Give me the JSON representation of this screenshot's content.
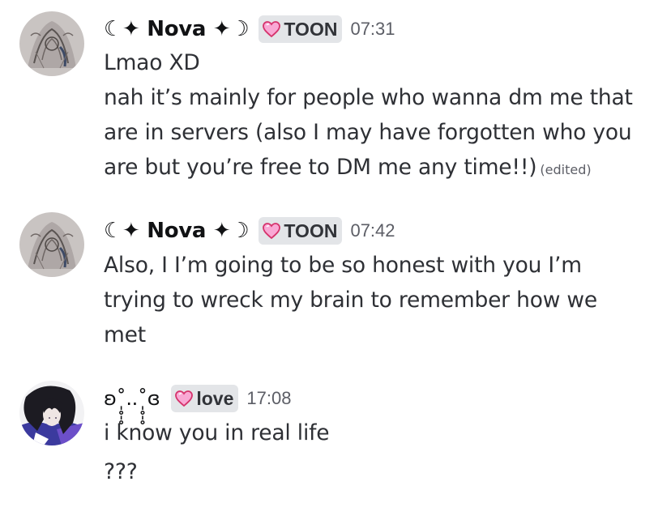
{
  "messages": [
    {
      "username": "☾✦ Nova ✦☽",
      "role_tag": "TOON",
      "timestamp": "07:31",
      "avatar_icon": "gothic-illustration-avatar",
      "lines": [
        "Lmao XD",
        "nah it’s mainly for people who wanna dm me that",
        "are in servers (also I may have forgotten who you",
        "are but you’re free to DM me any time!!)"
      ],
      "edited_label": "(edited)"
    },
    {
      "username": "☾✦ Nova ✦☽",
      "role_tag": "TOON",
      "timestamp": "07:42",
      "avatar_icon": "gothic-illustration-avatar",
      "lines": [
        "Also, I I’m going to be so honest with you I’m",
        "trying to wreck my brain to remember how we",
        "met"
      ]
    },
    {
      "username": "ʚ˚̩̥̩̥..˚̩̥̩̥ɞ",
      "role_tag": "love",
      "timestamp": "17:08",
      "avatar_icon": "dark-haired-character-avatar",
      "lines": [
        "i know you in real life",
        "???"
      ]
    }
  ],
  "colors": {
    "heart_fill": "#f9a8d4",
    "heart_stroke": "#d6336c",
    "tag_bg": "#e3e5e8",
    "timestamp": "#5c5e66"
  }
}
